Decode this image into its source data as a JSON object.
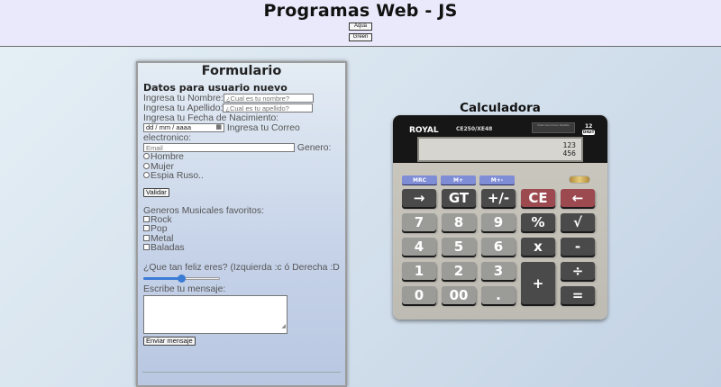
{
  "header": {
    "title": "Programas Web - JS",
    "theme_buttons": [
      "Aqua",
      "Green"
    ]
  },
  "form": {
    "title": "Formulario",
    "section_title": "Datos para usuario nuevo",
    "name_label": "Ingresa tu Nombre:",
    "name_placeholder": "¿Cual es tu nombre?",
    "lastname_label": "Ingresa tu Apellido:",
    "lastname_placeholder": "¿Cual es tu apellido?",
    "birthdate_label": "Ingresa tu Fecha de Nacimiento:",
    "birthdate_placeholder": "dd / mm / aaaa",
    "email_label": "Ingresa tu Correo electronico:",
    "email_placeholder": "Email",
    "gender_label": "Genero:",
    "gender_options": [
      "Hombre",
      "Mujer",
      "Espia Ruso.."
    ],
    "validate_button": "Validar",
    "genres_label": "Generos Musicales favoritos:",
    "genres": [
      "Rock",
      "Pop",
      "Metal",
      "Baladas"
    ],
    "happiness_label": "¿Que tan feliz eres? (Izquierda :c ó Derecha :D",
    "happiness_value": 0.5,
    "message_label": "Escribe tu mensaje:",
    "send_button": "Enviar mensaje"
  },
  "calculator": {
    "title": "Calculadora",
    "brand": "ROYAL",
    "model": "CE250/XE48",
    "solar_text": "Pattic Auto Power Reliable",
    "digits_label": "12",
    "digits_sub": "DIGIT",
    "display_line1": "123",
    "display_line2": "456",
    "memory_keys": [
      "MRC",
      "M+",
      "M+-"
    ],
    "keys": {
      "arrow": "→",
      "gt": "GT",
      "sign": "+/-",
      "ce": "CE",
      "back": "←",
      "k7": "7",
      "k8": "8",
      "k9": "9",
      "pct": "%",
      "sqrt": "√",
      "k4": "4",
      "k5": "5",
      "k6": "6",
      "mul": "x",
      "minus": "-",
      "k1": "1",
      "k2": "2",
      "k3": "3",
      "plus": "+",
      "div": "÷",
      "k0": "0",
      "k00": "00",
      "dot": ".",
      "eq": "="
    }
  }
}
